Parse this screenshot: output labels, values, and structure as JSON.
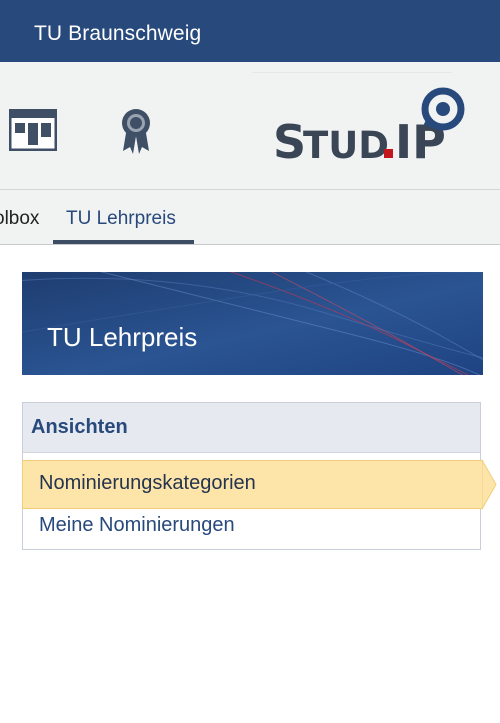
{
  "topbar": {
    "title": "TU Braunschweig"
  },
  "header": {
    "icons": [
      "board-icon",
      "award-icon"
    ],
    "logo_text": "STUD.IP"
  },
  "tabs": [
    {
      "label": "olbox",
      "active": false
    },
    {
      "label": "TU Lehrpreis",
      "active": true
    }
  ],
  "banner": {
    "title": "TU Lehrpreis"
  },
  "sidebar": {
    "title": "Ansichten",
    "items": [
      {
        "label": "Nominierungskategorien",
        "active": true
      },
      {
        "label": "Meine Nominierungen",
        "active": false
      }
    ]
  },
  "colors": {
    "topbar": "#28497c",
    "link": "#28497c",
    "active_item": "#fde4a9"
  }
}
